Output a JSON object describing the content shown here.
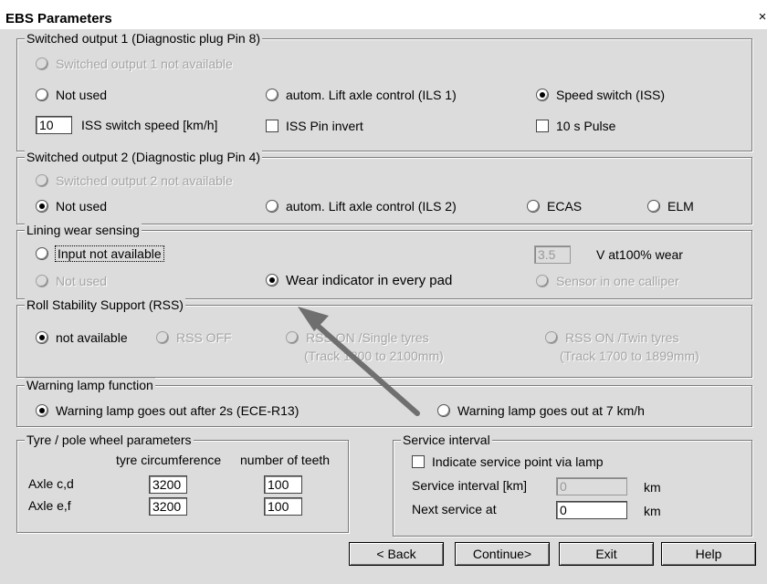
{
  "window": {
    "title": "EBS Parameters",
    "close_icon": "×"
  },
  "switched_output_1": {
    "legend": "Switched output 1   (Diagnostic plug Pin 8)",
    "not_available": "Switched output 1 not available",
    "not_used": "Not used",
    "ils1": "autom. Lift axle control (ILS 1)",
    "speed_switch": "Speed switch (ISS)",
    "speed_value": "10",
    "speed_label": "ISS switch speed [km/h]",
    "pin_invert": "ISS Pin invert",
    "pulse": "10 s Pulse"
  },
  "switched_output_2": {
    "legend": "Switched output 2   (Diagnostic plug Pin 4)",
    "not_available": "Switched output 2 not available",
    "not_used": "Not used",
    "ils2": "autom. Lift axle control (ILS 2)",
    "ecas": "ECAS",
    "elm": "ELM"
  },
  "lining": {
    "legend": "Lining wear sensing",
    "input_not_available": "Input not available",
    "voltage_value": "3.5",
    "voltage_label": "V  at100% wear",
    "not_used": "Not used",
    "wear_indicator": "Wear indicator in every pad",
    "sensor_one": "Sensor in one calliper"
  },
  "rss": {
    "legend": "Roll Stability Support (RSS)",
    "not_available": "not available",
    "off": "RSS OFF",
    "single": "RSS ON /Single tyres",
    "single_track": "(Track 1800 to 2100mm)",
    "twin": "RSS ON /Twin tyres",
    "twin_track": "(Track 1700 to 1899mm)"
  },
  "warning": {
    "legend": "Warning lamp function",
    "after2s": "Warning lamp goes out after 2s  (ECE-R13)",
    "at7": "Warning lamp goes out at 7 km/h"
  },
  "tyre": {
    "legend": "Tyre / pole wheel parameters",
    "col_circ": "tyre circumference",
    "col_teeth": "number of teeth",
    "axle_cd": "Axle c,d",
    "axle_ef": "Axle e,f",
    "cd_circ": "3200",
    "cd_teeth": "100",
    "ef_circ": "3200",
    "ef_teeth": "100"
  },
  "service": {
    "legend": "Service interval",
    "indicate": "Indicate service point via lamp",
    "interval_label": "Service interval [km]",
    "interval_value": "0",
    "interval_unit": "km",
    "next_label": "Next service at",
    "next_value": "0",
    "next_unit": "km"
  },
  "buttons": {
    "back": "< Back",
    "continue": "Continue>",
    "exit": "Exit",
    "help": "Help"
  },
  "annotation": {
    "arrow_color": "#6f6f6f"
  }
}
